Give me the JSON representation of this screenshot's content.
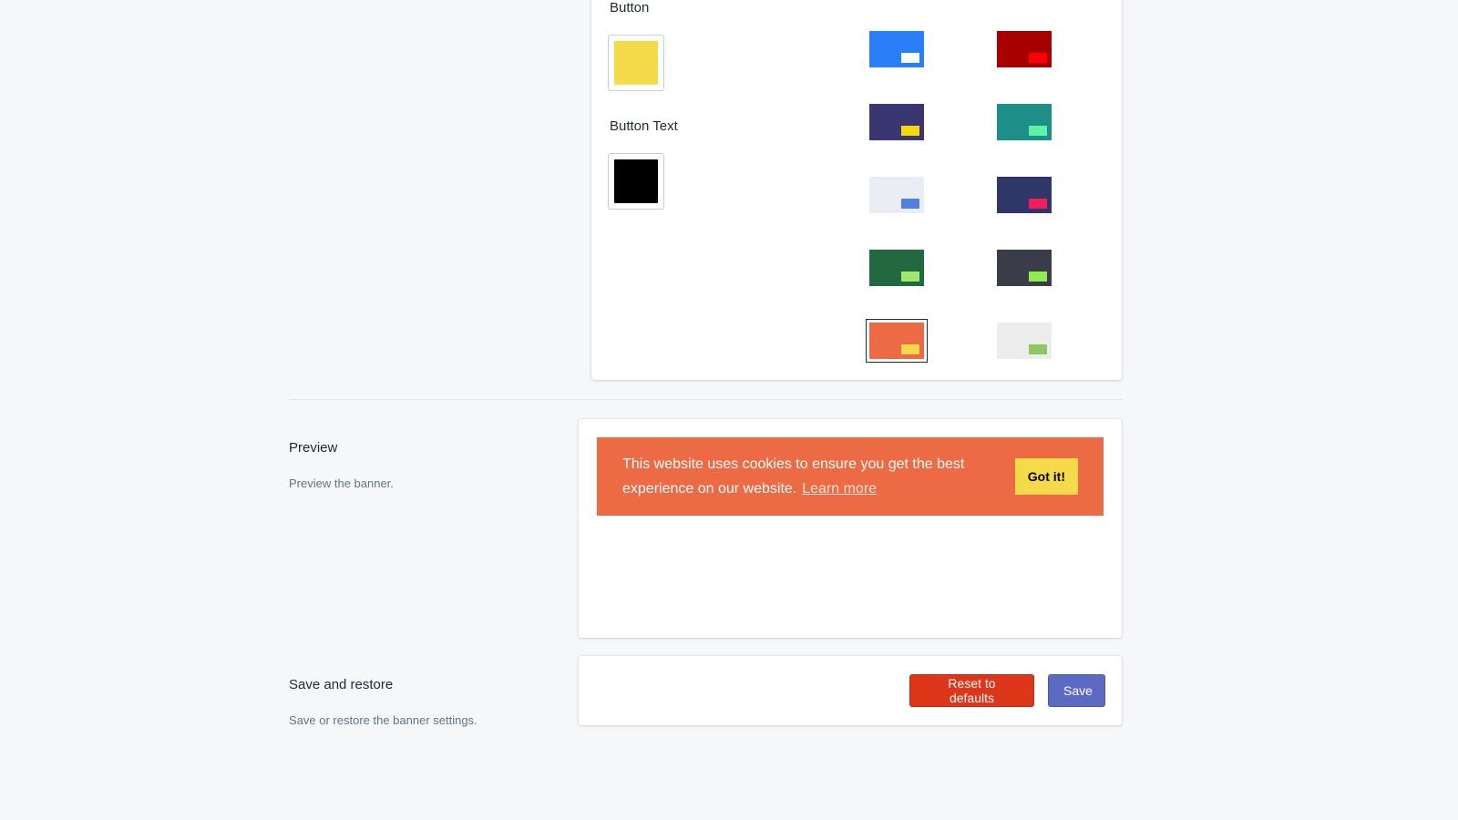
{
  "colors": {
    "button_label": "Button",
    "button_color": "#f5db4a",
    "button_text_label": "Button Text",
    "button_text_color": "#000000",
    "themes": [
      {
        "bg": "#2a7ef8",
        "accent": "#ffffff",
        "selected": false
      },
      {
        "bg": "#a60001",
        "accent": "#fb0002",
        "selected": false
      },
      {
        "bg": "#3a3671",
        "accent": "#f5d90d",
        "selected": false
      },
      {
        "bg": "#1e8f88",
        "accent": "#5cf3a6",
        "selected": false
      },
      {
        "bg": "#ebedf4",
        "accent": "#5081e1",
        "selected": false
      },
      {
        "bg": "#2f3768",
        "accent": "#f51d5a",
        "selected": false
      },
      {
        "bg": "#226942",
        "accent": "#a3e66d",
        "selected": false
      },
      {
        "bg": "#3a3d48",
        "accent": "#8fec4e",
        "selected": false
      },
      {
        "bg": "#ec6b45",
        "accent": "#f5d94a",
        "selected": true
      },
      {
        "bg": "#ededed",
        "accent": "#8ec760",
        "selected": false
      }
    ]
  },
  "preview": {
    "title": "Preview",
    "description": "Preview the banner.",
    "banner": {
      "message": "This website uses cookies to ensure you get the best experience on our website.",
      "link_text": "Learn more",
      "button_text": "Got it!",
      "background": "#ec6b45",
      "text_color": "#ffffff",
      "button_bg": "#f5db4a",
      "button_text_color": "#000000"
    }
  },
  "save_restore": {
    "title": "Save and restore",
    "description": "Save or restore the banner settings.",
    "reset_label": "Reset to defaults",
    "reset_color": "#de3618",
    "save_label": "Save",
    "save_color": "#5c6ac4"
  }
}
